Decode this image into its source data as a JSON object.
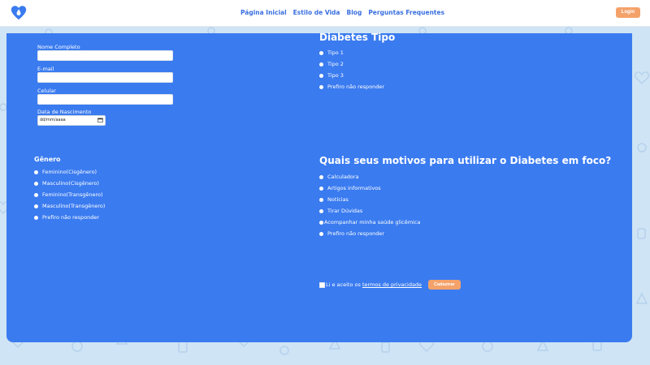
{
  "colors": {
    "accent": "#3a7bf0",
    "nav_link": "#3a6fe0",
    "button": "#f4a26a",
    "background": "#cfe4f5"
  },
  "nav": {
    "links": [
      "Página Inicial",
      "Estilo de Vida",
      "Blog",
      "Perguntas Frequentes"
    ],
    "login_label": "Login",
    "logo_icon": "heart-drop-icon"
  },
  "form": {
    "fields": [
      {
        "label": "Nome Completo",
        "value": ""
      },
      {
        "label": "E-mail",
        "value": ""
      },
      {
        "label": "Celular",
        "value": ""
      }
    ],
    "date": {
      "label": "Data de Nascimento",
      "placeholder": "dd/mm/aaaa",
      "icon": "calendar-icon"
    },
    "genero": {
      "title": "Gênero",
      "options": [
        "Feminino(Cisgênero)",
        "Masculino(Cisgênero)",
        "Feminino(Transgênero)",
        "Masculino(Transgênero)",
        "Prefiro não responder"
      ]
    },
    "diabetes": {
      "title": "Diabetes Tipo",
      "options": [
        "Tipo 1",
        "Tipo 2",
        "Tipo 3",
        "Prefiro não responder"
      ]
    },
    "motivos": {
      "title": "Quais seus motivos para utilizar o Diabetes em foco?",
      "options": [
        "Calculadora",
        "Artigos informativos",
        "Notícias",
        "Tirar Dúvidas",
        "Acompanhar minha saúde glicêmica",
        "Prefiro não responder"
      ]
    },
    "terms": {
      "prefix": "Li e aceito os ",
      "link": "termos de privacidade"
    },
    "submit_label": "Cadastrar"
  }
}
